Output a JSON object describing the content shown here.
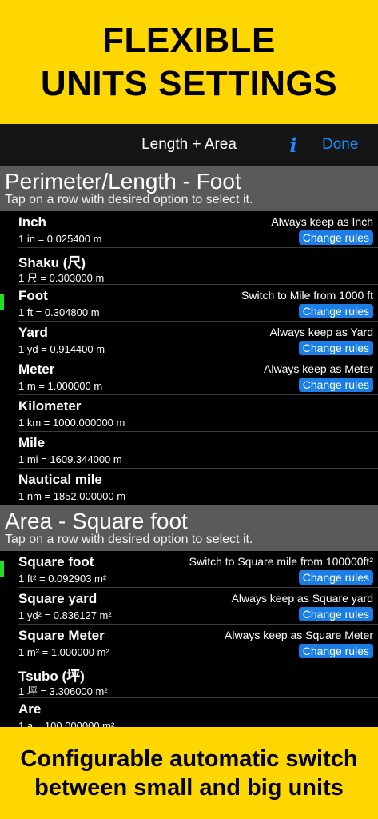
{
  "banner_top": {
    "line1": "FLEXIBLE",
    "line2": "UNITS SETTINGS"
  },
  "banner_bottom": {
    "line1": "Configurable automatic switch",
    "line2": "between small and big units"
  },
  "navbar": {
    "title": "Length + Area",
    "info_glyph": "i",
    "done_label": "Done"
  },
  "sections": [
    {
      "title": "Perimeter/Length - Foot",
      "subtitle": "Tap on a row with desired option to select it.",
      "rows": [
        {
          "name": "Inch",
          "conv": "1 in = 0.025400 m",
          "rule": "Always keep as Inch",
          "button": "Change rules",
          "selected": false
        },
        {
          "name": "Shaku (尺)",
          "conv": "1 尺 = 0.303000 m",
          "rule": "",
          "button": "",
          "selected": false
        },
        {
          "name": "Foot",
          "conv": "1 ft = 0.304800 m",
          "rule": "Switch to Mile from 1000 ft",
          "button": "Change rules",
          "selected": true
        },
        {
          "name": "Yard",
          "conv": "1 yd = 0.914400 m",
          "rule": "Always keep as Yard",
          "button": "Change rules",
          "selected": false
        },
        {
          "name": "Meter",
          "conv": "1 m = 1.000000 m",
          "rule": "Always keep as Meter",
          "button": "Change rules",
          "selected": false
        },
        {
          "name": "Kilometer",
          "conv": "1 km = 1000.000000 m",
          "rule": "",
          "button": "",
          "selected": false
        },
        {
          "name": "Mile",
          "conv": "1 mi = 1609.344000 m",
          "rule": "",
          "button": "",
          "selected": false
        },
        {
          "name": "Nautical mile",
          "conv": "1 nm = 1852.000000 m",
          "rule": "",
          "button": "",
          "selected": false
        }
      ]
    },
    {
      "title": "Area - Square foot",
      "subtitle": "Tap on a row with desired option to select it.",
      "rows": [
        {
          "name": "Square foot",
          "conv": "1 ft² = 0.092903 m²",
          "rule": "Switch to Square mile from 100000ft²",
          "button": "Change rules",
          "selected": true
        },
        {
          "name": "Square yard",
          "conv": "1 yd² = 0.836127 m²",
          "rule": "Always keep as Square yard",
          "button": "Change rules",
          "selected": false
        },
        {
          "name": "Square Meter",
          "conv": "1 m² = 1.000000 m²",
          "rule": "Always keep as Square Meter",
          "button": "Change rules",
          "selected": false
        },
        {
          "name": "Tsubo (坪)",
          "conv": "1 坪 = 3.306000 m²",
          "rule": "",
          "button": "",
          "selected": false
        },
        {
          "name": "Are",
          "conv": "1 a = 100.000000 m²",
          "rule": "",
          "button": "",
          "selected": false
        }
      ]
    }
  ],
  "colors": {
    "banner": "#FFD700",
    "accent": "#1a8cff",
    "button": "#1a7ee6",
    "selected_marker": "#22dd22",
    "section_header": "#5a5a5a"
  }
}
